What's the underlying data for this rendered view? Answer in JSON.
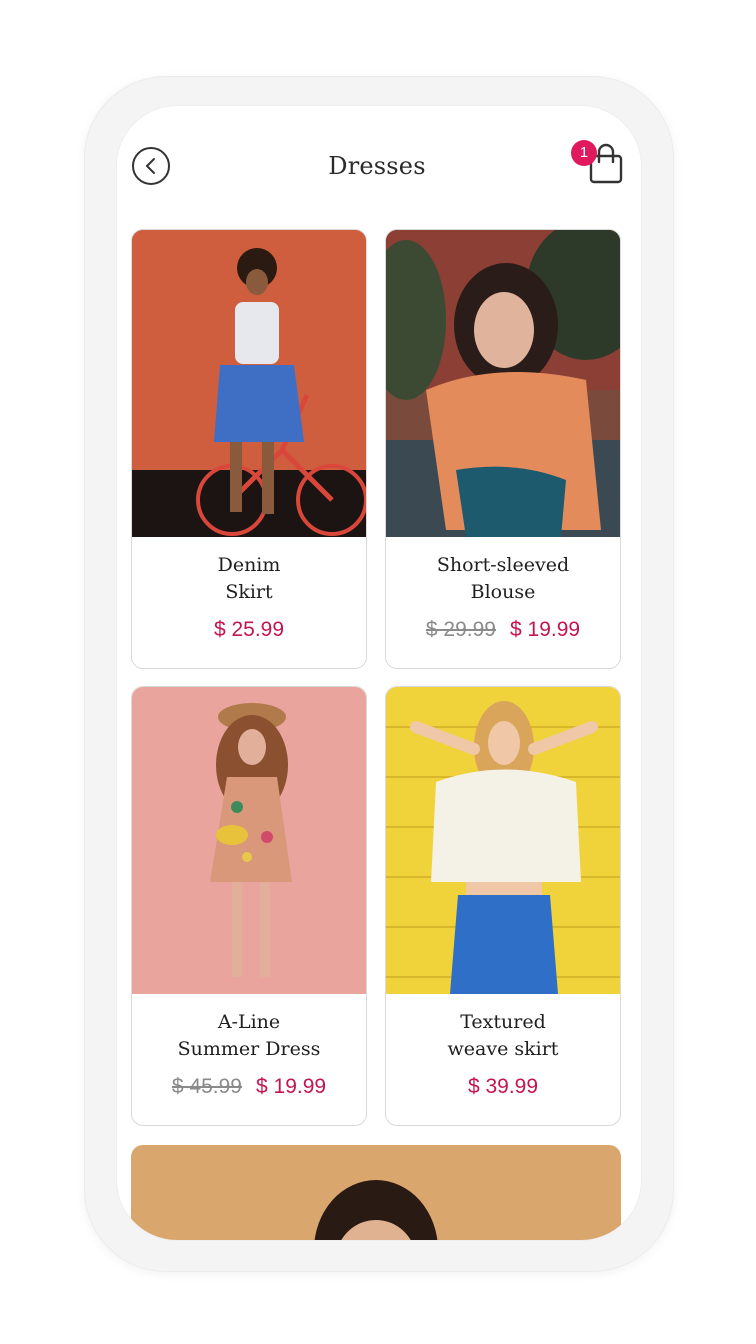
{
  "header": {
    "title": "Dresses",
    "cart_count": "1",
    "back_icon": "chevron-left-icon",
    "cart_icon": "shopping-bag-icon"
  },
  "products": [
    {
      "name": "Denim\nSkirt",
      "old_price": "",
      "price": "$ 25.99"
    },
    {
      "name": "Short-sleeved\nBlouse",
      "old_price": "$ 29.99",
      "price": "$ 19.99"
    },
    {
      "name": "A-Line\nSummer Dress",
      "old_price": "$ 45.99",
      "price": "$ 19.99"
    },
    {
      "name": "Textured\nweave skirt",
      "old_price": "",
      "price": "$ 39.99"
    }
  ],
  "colors": {
    "accent": "#c4154f",
    "badge": "#e0195e",
    "old_price": "#8a8a8a"
  }
}
